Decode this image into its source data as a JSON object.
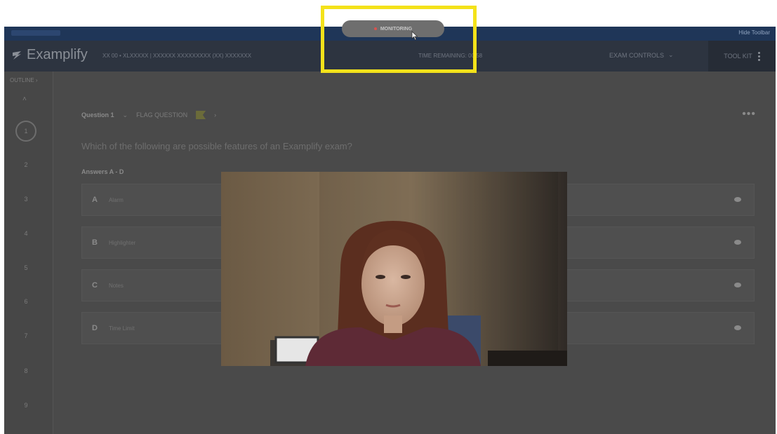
{
  "app": {
    "name": "Examplify"
  },
  "topbar": {
    "right_text": "Hide Toolbar"
  },
  "header": {
    "course": "XX 00 • XLXXXXX | XXXXXX XXXXXXXXX (XX) XXXXXXX",
    "time_remaining": "TIME REMAINING: 00:58",
    "exam_controls": "EXAM CONTROLS",
    "tool_kit": "TOOL KIT"
  },
  "sidebar": {
    "outline_label": "OUTLINE",
    "questions": [
      "1",
      "2",
      "3",
      "4",
      "5",
      "6",
      "7",
      "8",
      "9"
    ],
    "active_question": "1"
  },
  "question": {
    "title": "Question 1",
    "flag_label": "FLAG QUESTION",
    "prompt": "Which of the following are possible features of an Examplify exam?",
    "answers_label": "Answers A - D",
    "answers": [
      {
        "letter": "A",
        "text": "Alarm"
      },
      {
        "letter": "B",
        "text": "Highlighter"
      },
      {
        "letter": "C",
        "text": "Notes"
      },
      {
        "letter": "D",
        "text": "Time Limit"
      }
    ]
  },
  "recording": {
    "label": "MONITORING"
  },
  "colors": {
    "highlight": "#f4e21a",
    "header": "#2d3440",
    "recording_dot": "#d9534f"
  },
  "icons": [
    "bolt-icon",
    "chevron-down-icon",
    "kebab-menu-icon",
    "flag-icon",
    "eye-icon",
    "cursor-icon",
    "recording-dot-icon"
  ]
}
